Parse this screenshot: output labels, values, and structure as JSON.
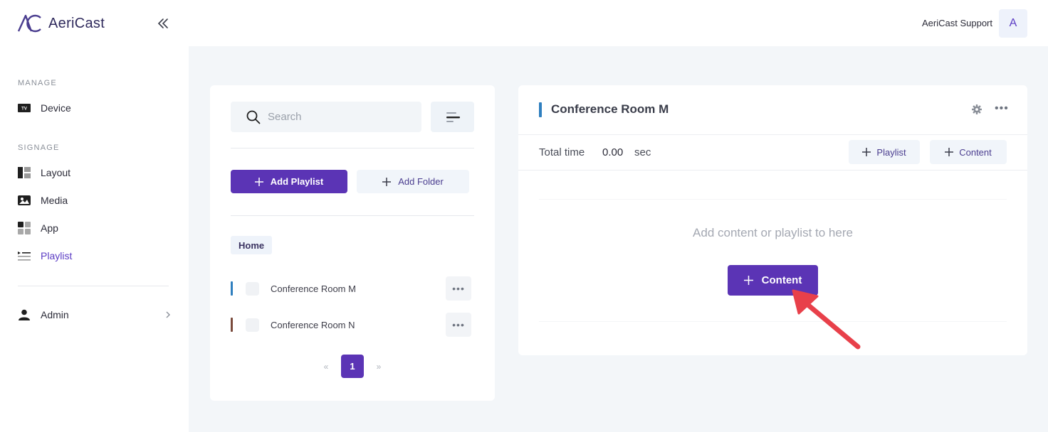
{
  "brand": {
    "name": "AeriCast"
  },
  "sidebar": {
    "manage_label": "MANAGE",
    "signage_label": "SIGNAGE",
    "items": [
      {
        "label": "Device",
        "icon": "tv-icon"
      },
      {
        "label": "Layout",
        "icon": "layout-icon"
      },
      {
        "label": "Media",
        "icon": "image-icon"
      },
      {
        "label": "App",
        "icon": "apps-grid-icon"
      },
      {
        "label": "Playlist",
        "icon": "playlist-icon",
        "active": true
      },
      {
        "label": "Admin",
        "icon": "user-icon"
      }
    ],
    "accent_color": "#5b3cc4"
  },
  "header": {
    "user_name": "AeriCast Support",
    "avatar_initial": "A"
  },
  "playlist_panel": {
    "search_placeholder": "Search",
    "add_playlist_label": "Add Playlist",
    "add_folder_label": "Add Folder",
    "breadcrumb": "Home",
    "rows": [
      {
        "name": "Conference Room M",
        "color": "#2f7fbf"
      },
      {
        "name": "Conference Room N",
        "color": "#7a4a3c"
      }
    ],
    "pagination": {
      "prev": "«",
      "current": "1",
      "next": "»"
    }
  },
  "detail_panel": {
    "title": "Conference Room M",
    "total_time_label": "Total time",
    "total_time_value": "0.00",
    "total_time_unit": "sec",
    "add_playlist_label": "Playlist",
    "add_content_label": "Content",
    "empty_message": "Add content or playlist to here",
    "content_button_label": "Content"
  }
}
